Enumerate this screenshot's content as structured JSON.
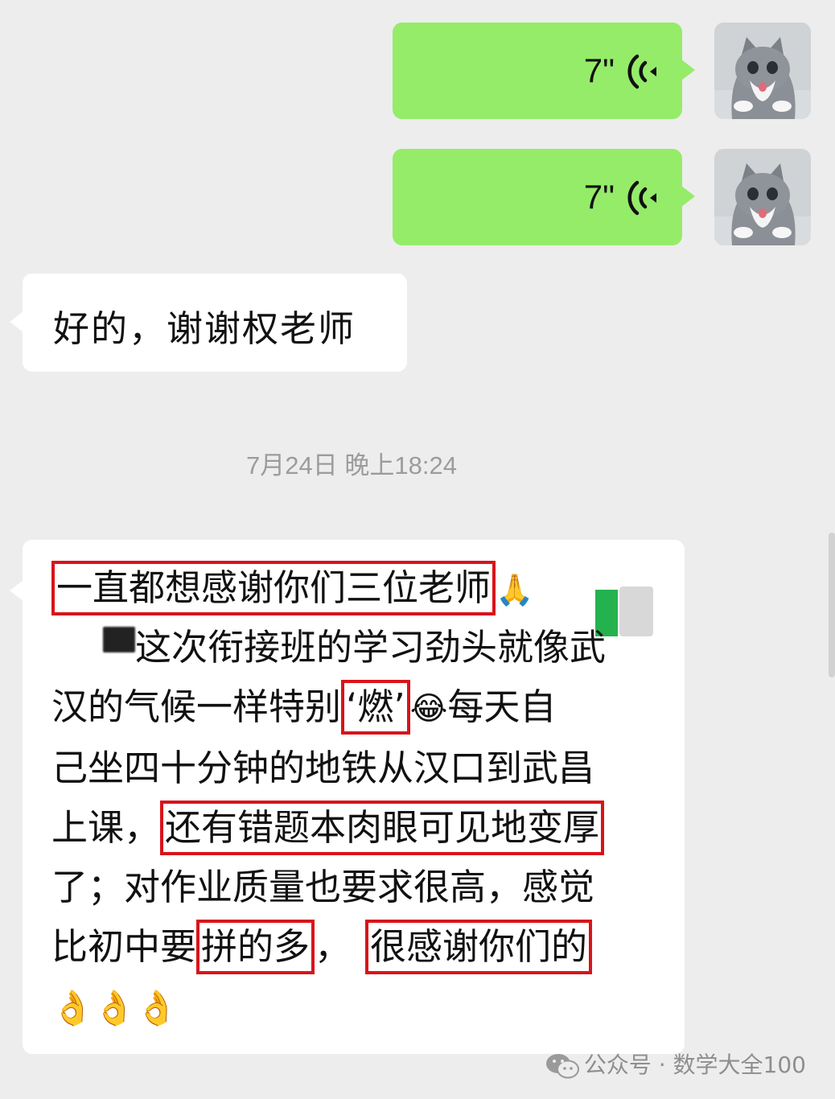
{
  "voice_messages": [
    {
      "duration": "7\"",
      "icon": "voice-wave-icon",
      "avatar": "cat-avatar"
    },
    {
      "duration": "7\"",
      "icon": "voice-wave-icon",
      "avatar": "cat-avatar"
    }
  ],
  "reply": {
    "text": "好的，谢谢权老师"
  },
  "timestamp": "7月24日 晚上18:24",
  "thanks_message": {
    "line1": "一直都想感谢你们三位老师",
    "line2": "这次衔接班的学习劲头就像武",
    "line3_a": "汉的气候一样特别",
    "line3_b": "‘燃’",
    "line3_emoji": "😂",
    "line3_c": "每天自",
    "line4": "己坐四十分钟的地铁从汉口到武昌",
    "line5_a": "上课，",
    "line5_b": "还有错题本肉眼可见地变厚",
    "line6": "了；对作业质量也要求很高，感觉",
    "line7_a": "比初中要",
    "line7_b": "拼的多",
    "line7_c": "，",
    "line7_d": "很感谢你们的",
    "emoji_pray": "🙏",
    "emoji_row": "👌👌👌"
  },
  "watermark": {
    "text": "公众号 · 数学大全100",
    "icon": "wechat-icon"
  },
  "colors": {
    "sent_bubble": "#95ec69",
    "background": "#ededed",
    "highlight": "#d8141b"
  }
}
